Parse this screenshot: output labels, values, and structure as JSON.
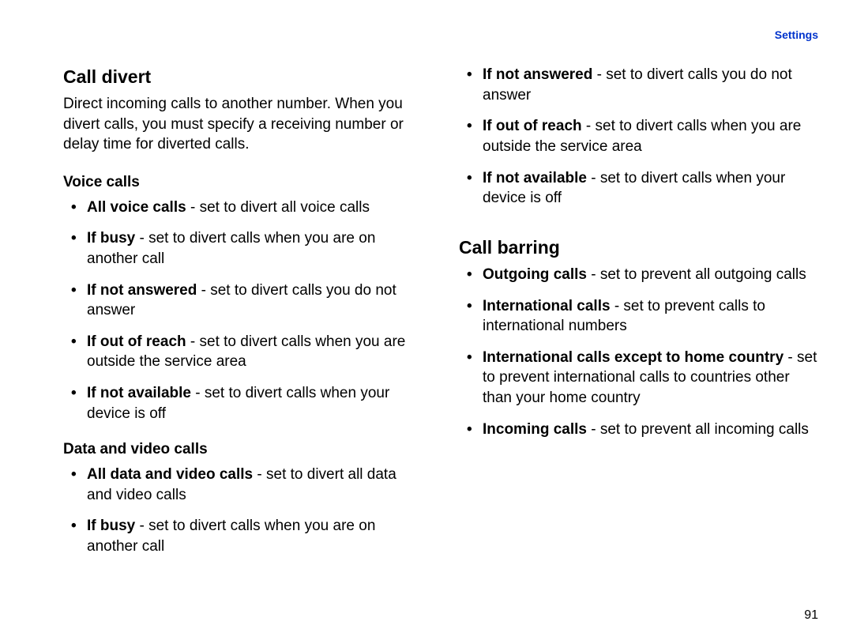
{
  "header": {
    "section": "Settings"
  },
  "page_number": "91",
  "section1": {
    "title": "Call divert",
    "intro": "Direct incoming calls to another number. When you divert calls, you must specify a receiving number or delay time for diverted calls.",
    "voice": {
      "heading": "Voice calls",
      "items": [
        {
          "term": "All voice calls",
          "desc": " - set to divert all voice calls"
        },
        {
          "term": "If busy",
          "desc": " - set to divert calls when you are on another call"
        },
        {
          "term": "If not answered",
          "desc": " - set to divert calls you do not answer"
        },
        {
          "term": "If out of reach",
          "desc": " - set to divert calls when you are outside the service area"
        },
        {
          "term": "If not available",
          "desc": " - set to divert calls when your device is off"
        }
      ]
    },
    "data_video": {
      "heading": "Data and video calls",
      "items": [
        {
          "term": "All data and video calls",
          "desc": " - set to divert all data and video calls"
        },
        {
          "term": "If busy",
          "desc": " - set to divert calls when you are on another call"
        },
        {
          "term": "If not answered",
          "desc": " - set to divert calls you do not answer"
        },
        {
          "term": "If out of reach",
          "desc": " - set to divert calls when you are outside the service area"
        },
        {
          "term": "If not available",
          "desc": " - set to divert calls when your device is off"
        }
      ]
    }
  },
  "section2": {
    "title": "Call barring",
    "items": [
      {
        "term": "Outgoing calls",
        "desc": " - set to prevent all outgoing calls"
      },
      {
        "term": "International calls",
        "desc": " - set to prevent calls to international numbers"
      },
      {
        "term": "International calls except to home country",
        "desc": " - set to prevent international calls to countries other than your home country"
      },
      {
        "term": "Incoming calls",
        "desc": " - set to prevent all incoming calls"
      }
    ]
  }
}
